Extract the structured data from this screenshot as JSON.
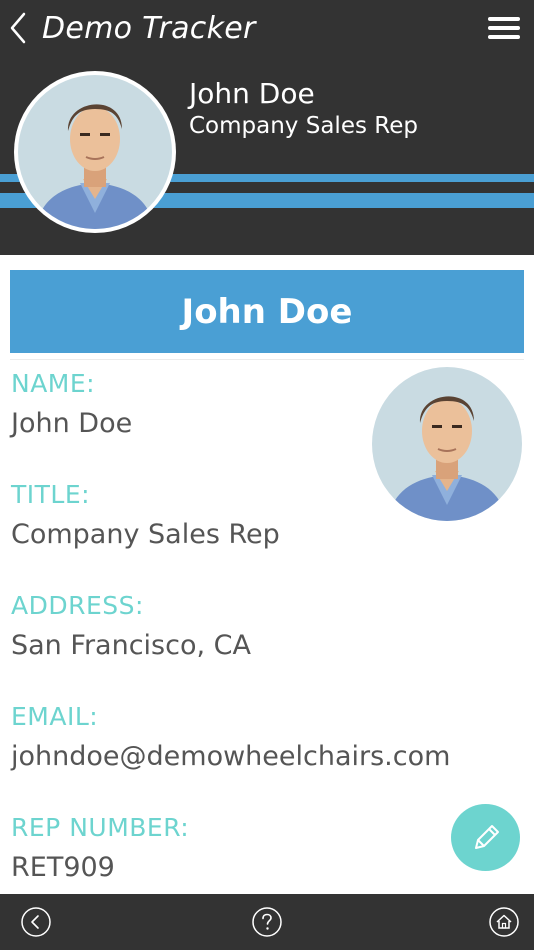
{
  "app": {
    "title": "Demo Tracker"
  },
  "header": {
    "name": "John Doe",
    "role": "Company Sales Rep"
  },
  "banner": {
    "name": "John Doe"
  },
  "fields": [
    {
      "label": "NAME:",
      "value": "John Doe"
    },
    {
      "label": "TITLE:",
      "value": "Company Sales Rep"
    },
    {
      "label": "ADDRESS:",
      "value": "San Francisco, CA"
    },
    {
      "label": "EMAIL:",
      "value": "johndoe@demowheelchairs.com"
    },
    {
      "label": "REP NUMBER:",
      "value": "RET909"
    }
  ],
  "icons": {
    "back": "chevron-left-icon",
    "menu": "hamburger-menu-icon",
    "edit": "pencil-icon",
    "nav_back": "circle-arrow-left-icon",
    "help": "question-circle-icon",
    "home": "home-circle-icon"
  },
  "colors": {
    "header_bg": "#333333",
    "accent_blue": "#4a9fd4",
    "label_teal": "#6dd4cf",
    "value_text": "#555555",
    "fab": "#6dd4cf"
  }
}
